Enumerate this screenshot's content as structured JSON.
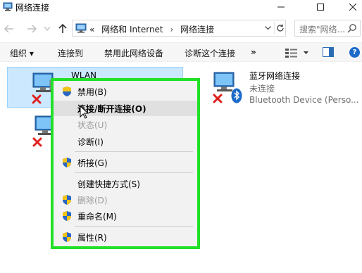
{
  "window": {
    "title": "网络连接"
  },
  "address": {
    "prefix": "«",
    "crumbs": [
      "网络和 Internet",
      "网络连接"
    ],
    "separator": "›",
    "search_placeholder": "搜索\"网络..."
  },
  "toolbar": {
    "organize": "组织 ▾",
    "connect": "连接到",
    "disable": "禁用此网络设备",
    "diagnose": "诊断这个连接",
    "more": "»",
    "help": "?"
  },
  "adapters": [
    {
      "name": "WLAN",
      "status": "",
      "device": "",
      "error_badge": true,
      "selected": true
    },
    {
      "name": "",
      "status": "",
      "device": "",
      "error_badge": true,
      "selected": false
    },
    {
      "name": "蓝牙网络连接",
      "status": "未连接",
      "device": "Bluetooth Device (Perso...",
      "error_badge": true,
      "selected": false
    }
  ],
  "context_menu": {
    "items": [
      {
        "label": "禁用(B)",
        "shield": true,
        "disabled": false,
        "highlighted": false,
        "bold": false
      },
      {
        "label": "连接/断开连接(O)",
        "shield": false,
        "disabled": false,
        "highlighted": true,
        "bold": true
      },
      {
        "label": "状态(U)",
        "shield": false,
        "disabled": true,
        "highlighted": false,
        "bold": false
      },
      {
        "label": "诊断(I)",
        "shield": false,
        "disabled": false,
        "highlighted": false,
        "bold": false
      },
      {
        "label": "桥接(G)",
        "shield": true,
        "disabled": false,
        "highlighted": false,
        "bold": false
      },
      {
        "label": "创建快捷方式(S)",
        "shield": false,
        "disabled": false,
        "highlighted": false,
        "bold": false
      },
      {
        "label": "删除(D)",
        "shield": true,
        "disabled": true,
        "highlighted": false,
        "bold": false
      },
      {
        "label": "重命名(M)",
        "shield": true,
        "disabled": false,
        "highlighted": false,
        "bold": false
      },
      {
        "label": "属性(R)",
        "shield": true,
        "disabled": false,
        "highlighted": false,
        "bold": false
      }
    ]
  },
  "colors": {
    "menu_highlight_border": "#22e027",
    "selection_bg": "#cce8ff",
    "error_red": "#e02020",
    "bluetooth_blue": "#1b6ac9"
  },
  "icons": {
    "app": "network-folder-icon",
    "back": "arrow-left-icon",
    "forward": "arrow-right-icon",
    "up": "arrow-up-icon",
    "refresh": "refresh-icon",
    "search": "search-icon",
    "adapter": "network-adapter-icon",
    "error": "red-x-icon",
    "bluetooth": "bluetooth-icon",
    "shield": "uac-shield-icon"
  }
}
